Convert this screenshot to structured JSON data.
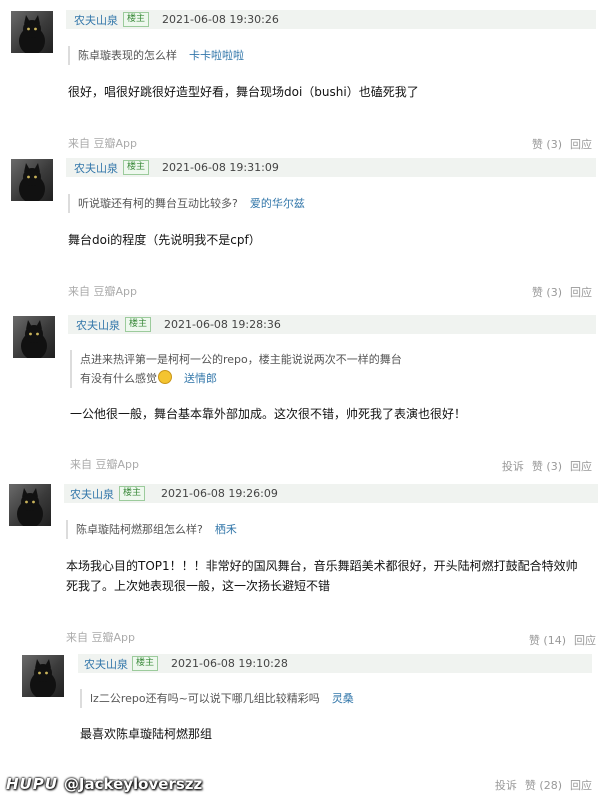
{
  "comments": [
    {
      "name": "农夫山泉",
      "badge": "楼主",
      "time": "2021-06-08 19:30:26",
      "quote": "陈卓璇表现的怎么样",
      "quote_author": "卡卡啦啦啦",
      "content": "很好，唱很好跳很好造型好看，舞台现场doi（bushi）也磕死我了",
      "source": "来自 豆瓣App",
      "like": "赞 (3)",
      "reply": "回应"
    },
    {
      "name": "农夫山泉",
      "badge": "楼主",
      "time": "2021-06-08 19:31:09",
      "quote": "听说璇还有柯的舞台互动比较多?",
      "quote_author": "爱的华尔兹",
      "content": "舞台doi的程度（先说明我不是cpf）",
      "source": "来自 豆瓣App",
      "like": "赞 (3)",
      "reply": "回应"
    },
    {
      "name": "农夫山泉",
      "badge": "楼主",
      "time": "2021-06-08 19:28:36",
      "quote": "点进来热评第一是柯柯一公的repo，楼主能说说两次不一样的舞台",
      "quote2": "有没有什么感觉",
      "quote_author": "送情郎",
      "content": "一公他很一般，舞台基本靠外部加成。这次很不错，帅死我了表演也很好！",
      "source": "来自 豆瓣App",
      "report": "投诉",
      "like": "赞 (3)",
      "reply": "回应"
    },
    {
      "name": "农夫山泉",
      "badge": "楼主",
      "time": "2021-06-08 19:26:09",
      "quote": "陈卓璇陆柯燃那组怎么样?",
      "quote_author": "栖禾",
      "content": "本场我心目的TOP1！！！非常好的国风舞台，音乐舞蹈美术都很好，开头陆柯燃打鼓配合特效帅",
      "content2": "死我了。上次她表现很一般，这一次扬长避短不错",
      "source": "来自 豆瓣App",
      "like": "赞 (14)",
      "reply": "回应"
    },
    {
      "name": "农夫山泉",
      "badge": "楼主",
      "time": "2021-06-08 19:10:28",
      "quote": "lz二公repo还有吗~可以说下哪几组比较精彩吗",
      "quote_author": "灵桑",
      "content": "最喜欢陈卓璇陆柯燃那组",
      "source": "来自 豆瓣App",
      "report": "投诉",
      "like": "赞 (28)",
      "reply": "回应"
    }
  ],
  "watermark": {
    "brand": "HUPU",
    "handle": "@Jackeyloverszz"
  },
  "colors": {
    "link": "#3377aa",
    "badge": "#3b8a3b",
    "header_bg": "#f0f3f0"
  }
}
